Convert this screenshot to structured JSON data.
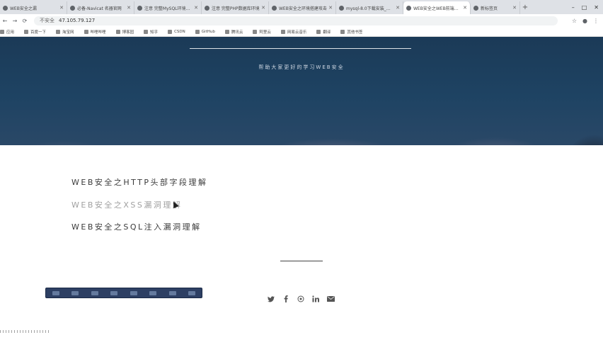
{
  "browser": {
    "tabs": [
      {
        "title": "WEB安全之漏",
        "active": false
      },
      {
        "title": "必备-Navicat 名器官网",
        "active": false
      },
      {
        "title": "注意 完整MySQL环境搭建",
        "active": false
      },
      {
        "title": "注意 完整PHP数据库环境",
        "active": false
      },
      {
        "title": "WEB安全之环境搭建攻击",
        "active": false
      },
      {
        "title": "mysql-8.0下载安装_数据库",
        "active": false
      },
      {
        "title": "WEB安全之WEB前端安全攻防",
        "active": true
      },
      {
        "title": "新标签页",
        "active": false
      }
    ],
    "new_tab": "+",
    "window_controls": [
      "–",
      "□",
      "✕"
    ],
    "address": "47.105.79.127",
    "security_label": "不安全",
    "bookmarks": [
      "应用",
      "百度一下",
      "淘宝网",
      "哔哩哔哩",
      "博客园",
      "知乎",
      "CSDN",
      "GitHub",
      "腾讯云",
      "阿里云",
      "网易云音乐",
      "翻译",
      "其他书签"
    ]
  },
  "hero": {
    "subtitle": "帮助大家更好的学习WEB安全"
  },
  "articles": [
    {
      "title": "WEB安全之HTTP头部字段理解",
      "state": "normal"
    },
    {
      "title": "WEB安全之XSS漏洞理解",
      "state": "hover"
    },
    {
      "title": "WEB安全之SQL注入漏洞理解",
      "state": "normal"
    }
  ],
  "social_icons": [
    "twitter-icon",
    "facebook-icon",
    "weibo-icon",
    "linkedin-icon",
    "email-icon"
  ],
  "colors": {
    "hero_bg": "#1e4363",
    "article_text": "#3a3a3a",
    "article_hover": "#a0a0a0",
    "player_bg": "#2d3f63"
  }
}
